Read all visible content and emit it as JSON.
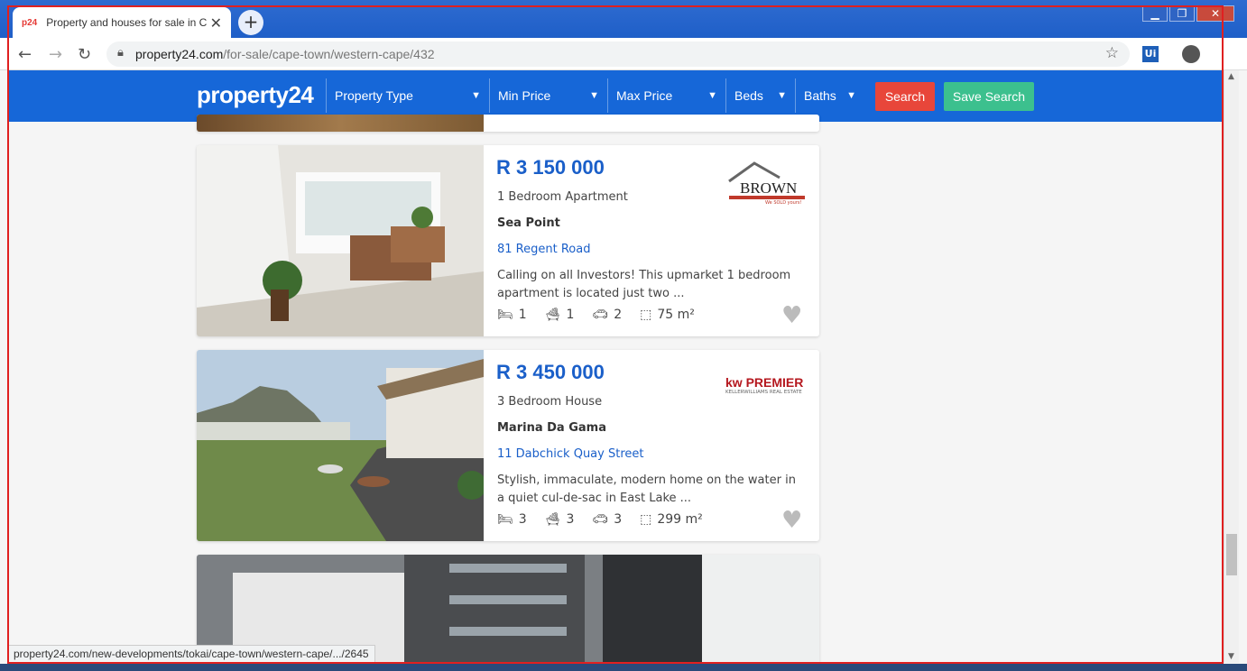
{
  "browser": {
    "tab_favicon": "p24",
    "tab_title": "Property and houses for sale in C",
    "tab_close": "✕",
    "new_tab": "+",
    "url_host": "property24.com",
    "url_path": "/for-sale/cape-town/western-cape/432",
    "extension_label": "Ui",
    "status_url": "property24.com/new-developments/tokai/cape-town/western-cape/.../2645"
  },
  "site": {
    "logo": "property24",
    "filters": [
      {
        "label": "Property Type"
      },
      {
        "label": "Min Price"
      },
      {
        "label": "Max Price"
      },
      {
        "label": "Beds"
      },
      {
        "label": "Baths"
      }
    ],
    "search_label": "Search",
    "save_search_label": "Save Search"
  },
  "listings": [
    {
      "price": "R 3 150 000",
      "type": "1 Bedroom Apartment",
      "suburb": "Sea Point",
      "street": "81 Regent Road",
      "description": "Calling on all Investors! This upmarket 1 bedroom apartment is located just two ...",
      "beds": "1",
      "baths": "1",
      "parking": "2",
      "size": "75 m²",
      "agency": {
        "name": "BROWN",
        "tagline": "We SOLD yours!"
      }
    },
    {
      "price": "R 3 450 000",
      "type": "3 Bedroom House",
      "suburb": "Marina Da Gama",
      "street": "11 Dabchick Quay Street",
      "description": "Stylish, immaculate, modern home on the water in a quiet cul-de-sac in East Lake ...",
      "beds": "3",
      "baths": "3",
      "parking": "3",
      "size": "299 m²",
      "agency": {
        "name": "kw PREMIER",
        "tagline": "KELLERWILLIAMS REAL ESTATE"
      }
    }
  ],
  "colors": {
    "brand_blue": "#1667d8",
    "search_red": "#e8463a",
    "save_green": "#3cc08e",
    "price_blue": "#1a5fc9"
  }
}
